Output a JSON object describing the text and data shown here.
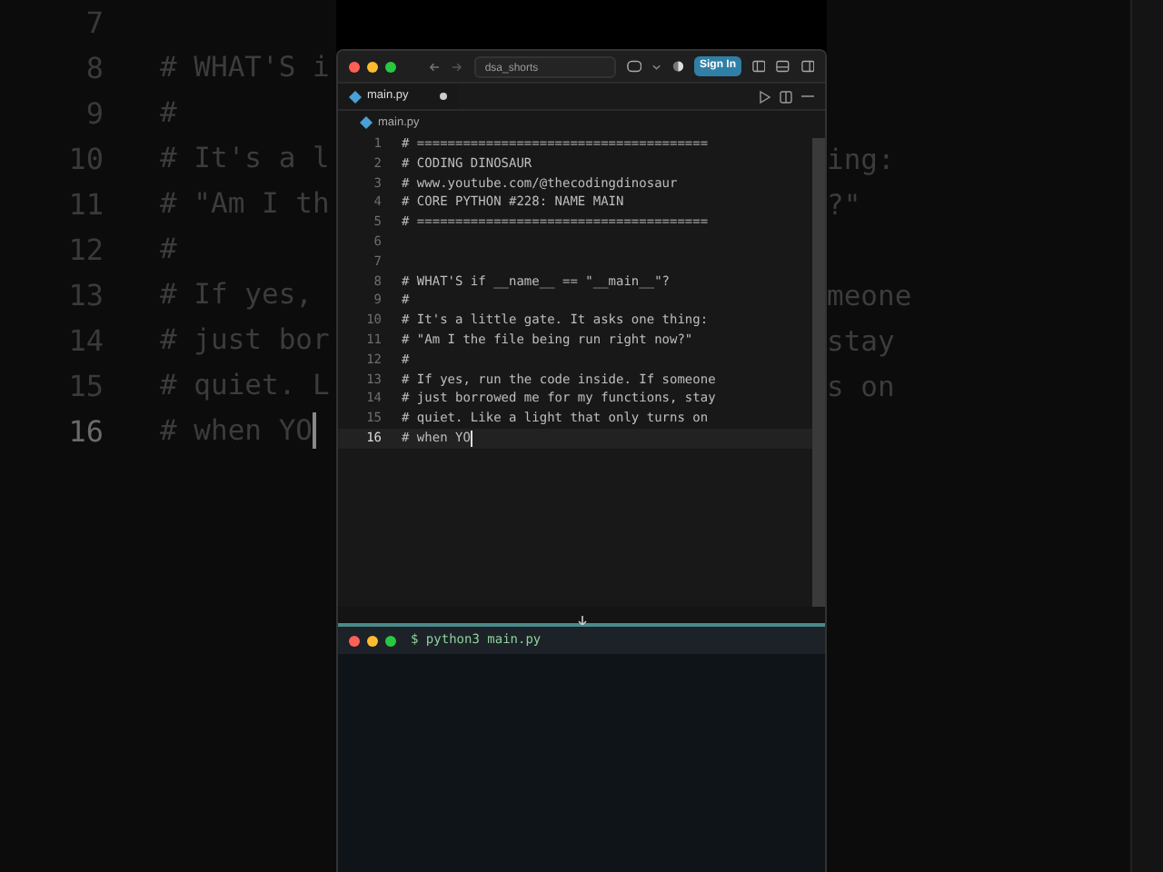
{
  "background_editor": {
    "lines": [
      {
        "number": "7",
        "current": false
      },
      {
        "number": "8",
        "left": "# WHAT'S i",
        "current": false
      },
      {
        "number": "9",
        "left": "#",
        "current": false
      },
      {
        "number": "10",
        "left": "# It's a l",
        "right": "ing:",
        "current": false
      },
      {
        "number": "11",
        "left": "# \"Am I th",
        "right": "?\"",
        "current": false
      },
      {
        "number": "12",
        "left": "#",
        "current": false
      },
      {
        "number": "13",
        "left": "# If yes,",
        "right": "meone",
        "current": false
      },
      {
        "number": "14",
        "left": "# just bor",
        "right": "stay",
        "current": false
      },
      {
        "number": "15",
        "left": "# quiet. L",
        "right": "s on",
        "current": false
      },
      {
        "number": "16",
        "left": "# when YO",
        "current": true
      }
    ]
  },
  "window": {
    "title_bar": {
      "search": "dsa_shorts",
      "sign_in": "Sign In"
    },
    "tabs": [
      {
        "label": "main.py",
        "modified": true,
        "selected": true
      }
    ],
    "breadcrumb": "main.py",
    "code_lines": [
      {
        "number": "1",
        "text": "# ======================================",
        "current": false
      },
      {
        "number": "2",
        "text": "# CODING DINOSAUR",
        "current": false
      },
      {
        "number": "3",
        "text": "# www.youtube.com/@thecodingdinosaur",
        "current": false
      },
      {
        "number": "4",
        "text": "# CORE PYTHON #228: NAME MAIN",
        "current": false
      },
      {
        "number": "5",
        "text": "# ======================================",
        "current": false
      },
      {
        "number": "6",
        "current": false
      },
      {
        "number": "7",
        "current": false
      },
      {
        "number": "8",
        "text": "# WHAT'S if __name__ == \"__main__\"?",
        "current": false
      },
      {
        "number": "9",
        "text": "#",
        "current": false
      },
      {
        "number": "10",
        "text": "# It's a little gate. It asks one thing:",
        "current": false
      },
      {
        "number": "11",
        "text": "# \"Am I the file being run right now?\"",
        "current": false
      },
      {
        "number": "12",
        "text": "#",
        "current": false
      },
      {
        "number": "13",
        "text": "# If yes, run the code inside. If someone",
        "current": false
      },
      {
        "number": "14",
        "text": "# just borrowed me for my functions, stay",
        "current": false
      },
      {
        "number": "15",
        "text": "# quiet. Like a light that only turns on",
        "current": false
      },
      {
        "number": "16",
        "text": "# when YO",
        "current": true
      }
    ],
    "terminal": {
      "command": "$ python3 main.py"
    }
  }
}
